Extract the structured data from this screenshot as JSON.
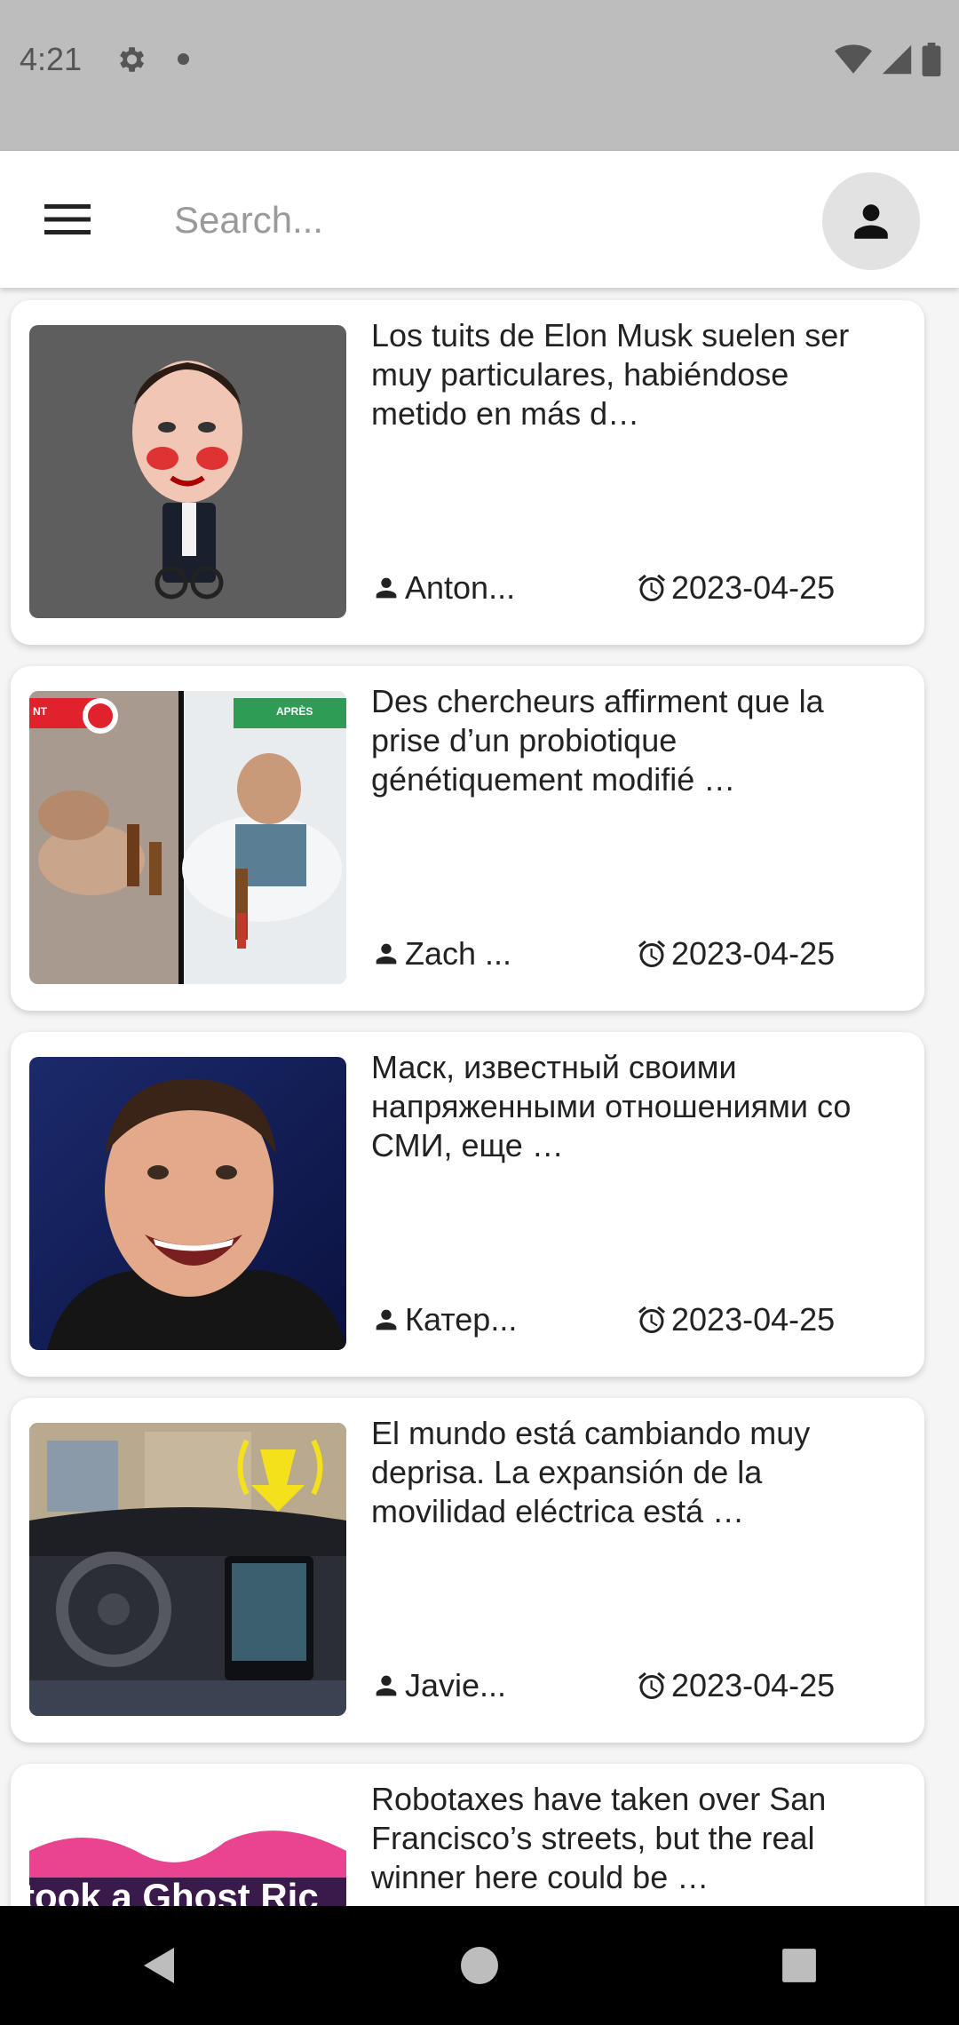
{
  "status": {
    "time": "4:21"
  },
  "search": {
    "placeholder": "Search..."
  },
  "articles": [
    {
      "headline": "Los tuits de Elon Musk suelen ser muy particulares, habiéndose metido en más d…",
      "author": "Anton...",
      "date": "2023-04-25",
      "image": "elon-musk-caricature"
    },
    {
      "headline": "Des chercheurs affirment que la prise d’un probiotique génétiquement modifié …",
      "author": "Zach ...",
      "date": "2023-04-25",
      "image": "before-after-drinking",
      "image_labels": [
        "NT",
        "APRÈS"
      ]
    },
    {
      "headline": "Маск, известный своими напряженными отношениями со СМИ, еще …",
      "author": "Катер...",
      "date": "2023-04-25",
      "image": "elon-musk-laughing"
    },
    {
      "headline": "El mundo está cambiando muy deprisa. La expansión de la movilidad eléctrica está …",
      "author": "Javie...",
      "date": "2023-04-25",
      "image": "car-interior"
    },
    {
      "headline": "Robotaxes have taken over San Francisco’s streets, but the real winner here could be …",
      "author": "",
      "date": "",
      "image": "ghost-ride-banner",
      "image_text": "took a Ghost Ric"
    }
  ],
  "colors": {
    "status_bar": "#bdbdbd",
    "app_bar": "#ffffff",
    "nav_bar": "#000000",
    "avatar_bg": "#e2e2e2"
  }
}
